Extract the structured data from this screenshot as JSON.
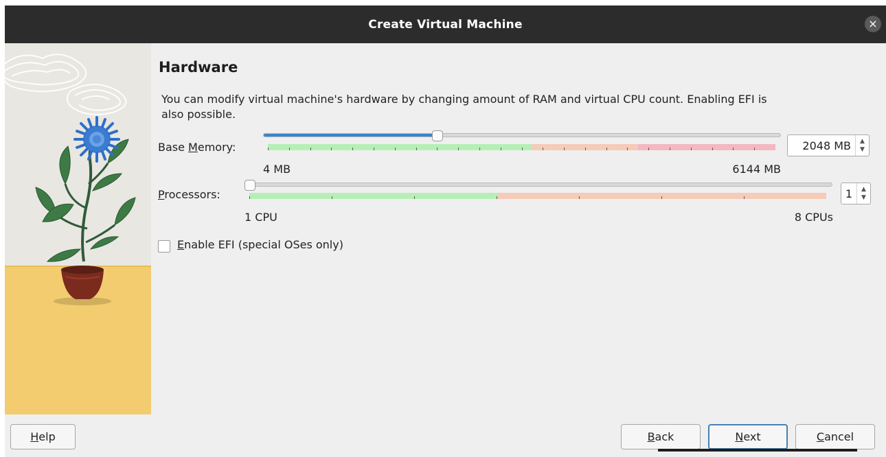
{
  "window": {
    "title": "Create Virtual Machine",
    "close_glyph": "×"
  },
  "page": {
    "heading": "Hardware",
    "description": "You can modify virtual machine's hardware by changing amount of RAM and virtual CPU count. Enabling EFI is also possible."
  },
  "memory": {
    "label_pre": "Base ",
    "label_mnemonic": "M",
    "label_post": "emory:",
    "min_label": "4 MB",
    "max_label": "6144 MB",
    "value_text": "2048 MB",
    "value_mb": 2048,
    "min_mb": 4,
    "max_mb": 6144,
    "zones": [
      "green",
      "orange",
      "red"
    ]
  },
  "processors": {
    "label_mnemonic": "P",
    "label_post": "rocessors:",
    "min_label": "1 CPU",
    "max_label": "8 CPUs",
    "value_text": "1",
    "value": 1,
    "min": 1,
    "max": 8,
    "zones": [
      "green",
      "orange"
    ]
  },
  "efi": {
    "label_mnemonic": "E",
    "label_post": "nable EFI (special OSes only)",
    "checked": false
  },
  "buttons": {
    "help_mnemonic": "H",
    "help_post": "elp",
    "back_mnemonic": "B",
    "back_post": "ack",
    "next_mnemonic": "N",
    "next_post": "ext",
    "cancel_mnemonic": "C",
    "cancel_post": "ancel"
  },
  "colors": {
    "titlebar": "#2c2c2c",
    "slider_fill": "#3d84c7",
    "zone_green": "#b6efb6",
    "zone_orange": "#f6cbb7",
    "zone_red": "#f4b8c0",
    "default_button_border": "#4a7fb6"
  },
  "icons": {
    "close": "close-icon",
    "spin_up": "chevron-up-icon",
    "spin_down": "chevron-down-icon",
    "illustration": "flower-pot-illustration"
  }
}
